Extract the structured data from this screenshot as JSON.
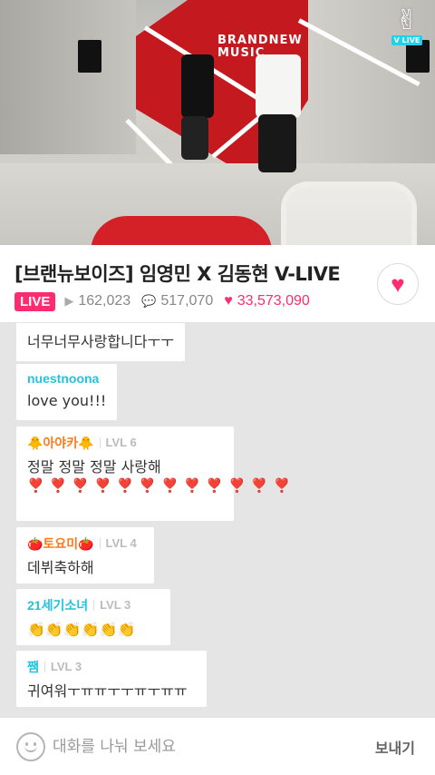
{
  "video": {
    "sign_text_line1": "BRANDNEW",
    "sign_text_line2": "MUSIC",
    "badge_label": "V LIVE"
  },
  "broadcast": {
    "title": "[브랜뉴보이즈] 임영민 X 김동현 V-LIVE",
    "live_label": "LIVE",
    "views": "162,023",
    "comments": "517,070",
    "hearts": "33,573,090"
  },
  "icons": {
    "views": "play-icon",
    "comments": "chat-bubble-icon",
    "hearts": "heart-icon",
    "emoji": "smile-icon"
  },
  "chat": {
    "messages": [
      {
        "name": "",
        "level": "",
        "text": "너무너무사랑합니다ㅜㅜ"
      },
      {
        "name": "nuestnoona",
        "level": "",
        "text": "love you!!!"
      },
      {
        "name": "🐥아야카🐥",
        "level": "LVL 6",
        "text": "정말 정말 정말 사랑해",
        "hearts": "❣️❣️❣️❣️❣️❣️❣️❣️❣️❣️❣️❣️"
      },
      {
        "name": "🍅토요미🍅",
        "level": "LVL 4",
        "text": "데뷔축하해"
      },
      {
        "name": "21세기소녀",
        "level": "LVL 3",
        "text": "👏👏👏👏👏👏"
      },
      {
        "name": "쨈",
        "level": "LVL 3",
        "text": "귀여워ㅜㅠㅠㅜㅜㅠㅜㅠㅠ"
      }
    ]
  },
  "input": {
    "placeholder": "대화를 나눠 보세요",
    "send_label": "보내기"
  },
  "colors": {
    "accent_pink": "#ff2d6f",
    "name_cyan": "#22c3dc",
    "name_orange": "#ff7a1a",
    "chat_bg": "#e5e5e5"
  }
}
